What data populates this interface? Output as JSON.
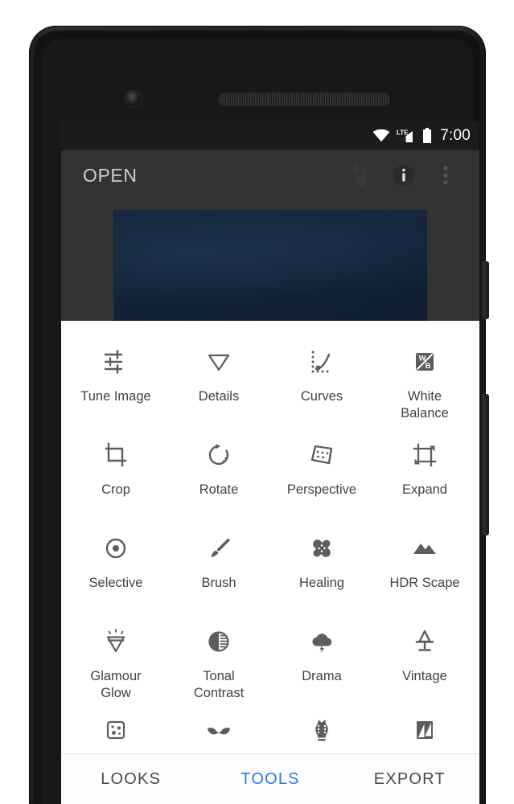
{
  "device": {
    "camera_icon": "front-camera-icon",
    "earpiece_icon": "earpiece-speaker-grille",
    "power_button": "power-button",
    "volume_button": "volume-rocker-button"
  },
  "status_bar": {
    "wifi_icon": "wifi-icon",
    "network_label": "LTE",
    "signal_icon": "cell-signal-icon",
    "battery_icon": "battery-full-icon",
    "time": "7:00"
  },
  "app_bar": {
    "title": "OPEN",
    "actions": [
      {
        "name": "stacks-icon",
        "label": "Stacks"
      },
      {
        "name": "info-icon",
        "label": "Info"
      },
      {
        "name": "overflow-menu-icon",
        "label": "More options"
      }
    ]
  },
  "preview": {
    "photo_alt": "photo-preview",
    "background_color": "#122339"
  },
  "tools": {
    "items": [
      {
        "label": "Tune Image",
        "icon": "tune-sliders-icon",
        "partial": false
      },
      {
        "label": "Details",
        "icon": "details-triangle-icon",
        "partial": false
      },
      {
        "label": "Curves",
        "icon": "curves-icon",
        "partial": false
      },
      {
        "label": "White\nBalance",
        "icon": "white-balance-icon",
        "partial": false
      },
      {
        "label": "Crop",
        "icon": "crop-icon",
        "partial": false
      },
      {
        "label": "Rotate",
        "icon": "rotate-icon",
        "partial": false
      },
      {
        "label": "Perspective",
        "icon": "perspective-icon",
        "partial": false
      },
      {
        "label": "Expand",
        "icon": "expand-icon",
        "partial": false
      },
      {
        "label": "Selective",
        "icon": "selective-icon",
        "partial": false
      },
      {
        "label": "Brush",
        "icon": "brush-icon",
        "partial": false
      },
      {
        "label": "Healing",
        "icon": "healing-bandage-icon",
        "partial": false
      },
      {
        "label": "HDR Scape",
        "icon": "hdr-mountains-icon",
        "partial": false
      },
      {
        "label": "Glamour\nGlow",
        "icon": "glamour-glow-icon",
        "partial": false
      },
      {
        "label": "Tonal\nContrast",
        "icon": "tonal-contrast-icon",
        "partial": false
      },
      {
        "label": "Drama",
        "icon": "drama-cloud-icon",
        "partial": false
      },
      {
        "label": "Vintage",
        "icon": "vintage-lamp-icon",
        "partial": false
      },
      {
        "label": "",
        "icon": "grainy-film-icon",
        "partial": true
      },
      {
        "label": "",
        "icon": "retrolux-moustache-icon",
        "partial": true
      },
      {
        "label": "",
        "icon": "grunge-icon",
        "partial": true
      },
      {
        "label": "",
        "icon": "double-exposure-icon",
        "partial": true
      }
    ]
  },
  "bottom_nav": {
    "active_color": "#2979e8",
    "tabs": [
      {
        "label": "LOOKS",
        "active": false
      },
      {
        "label": "TOOLS",
        "active": true
      },
      {
        "label": "EXPORT",
        "active": false
      }
    ]
  }
}
